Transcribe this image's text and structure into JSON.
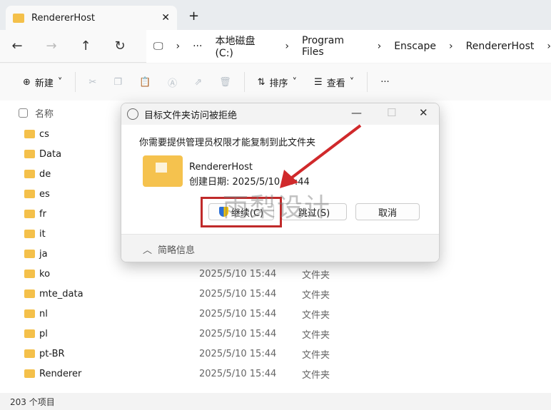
{
  "tab": {
    "title": "RendererHost",
    "close": "✕",
    "new": "+"
  },
  "nav": {
    "back": "←",
    "forward": "→",
    "up": "↑",
    "refresh": "↻",
    "more": "···",
    "crumbs": [
      "本地磁盘 (C:)",
      "Program Files",
      "Enscape",
      "RendererHost"
    ]
  },
  "toolbar": {
    "new": "新建",
    "sort": "排序",
    "view": "查看",
    "more": "···"
  },
  "list": {
    "header": "名称",
    "rows": [
      {
        "name": "cs",
        "date": "",
        "type": ""
      },
      {
        "name": "Data",
        "date": "",
        "type": ""
      },
      {
        "name": "de",
        "date": "",
        "type": ""
      },
      {
        "name": "es",
        "date": "",
        "type": ""
      },
      {
        "name": "fr",
        "date": "",
        "type": ""
      },
      {
        "name": "it",
        "date": "",
        "type": ""
      },
      {
        "name": "ja",
        "date": "",
        "type": ""
      },
      {
        "name": "ko",
        "date": "2025/5/10 15:44",
        "type": "文件夹"
      },
      {
        "name": "mte_data",
        "date": "2025/5/10 15:44",
        "type": "文件夹"
      },
      {
        "name": "nl",
        "date": "2025/5/10 15:44",
        "type": "文件夹"
      },
      {
        "name": "pl",
        "date": "2025/5/10 15:44",
        "type": "文件夹"
      },
      {
        "name": "pt-BR",
        "date": "2025/5/10 15:44",
        "type": "文件夹"
      },
      {
        "name": "Renderer",
        "date": "2025/5/10 15:44",
        "type": "文件夹"
      }
    ]
  },
  "status": "203 个项目",
  "dialog": {
    "title": "目标文件夹访问被拒绝",
    "message": "你需要提供管理员权限才能复制到此文件夹",
    "folder_name": "RendererHost",
    "created": "创建日期: 2025/5/10 15:44",
    "continue": "继续(C)",
    "skip": "跳过(S)",
    "cancel": "取消",
    "details": "简略信息"
  },
  "watermark": "雨梨设计",
  "colors": {
    "annotation": "#c02a2a",
    "folder": "#f4c04a"
  }
}
